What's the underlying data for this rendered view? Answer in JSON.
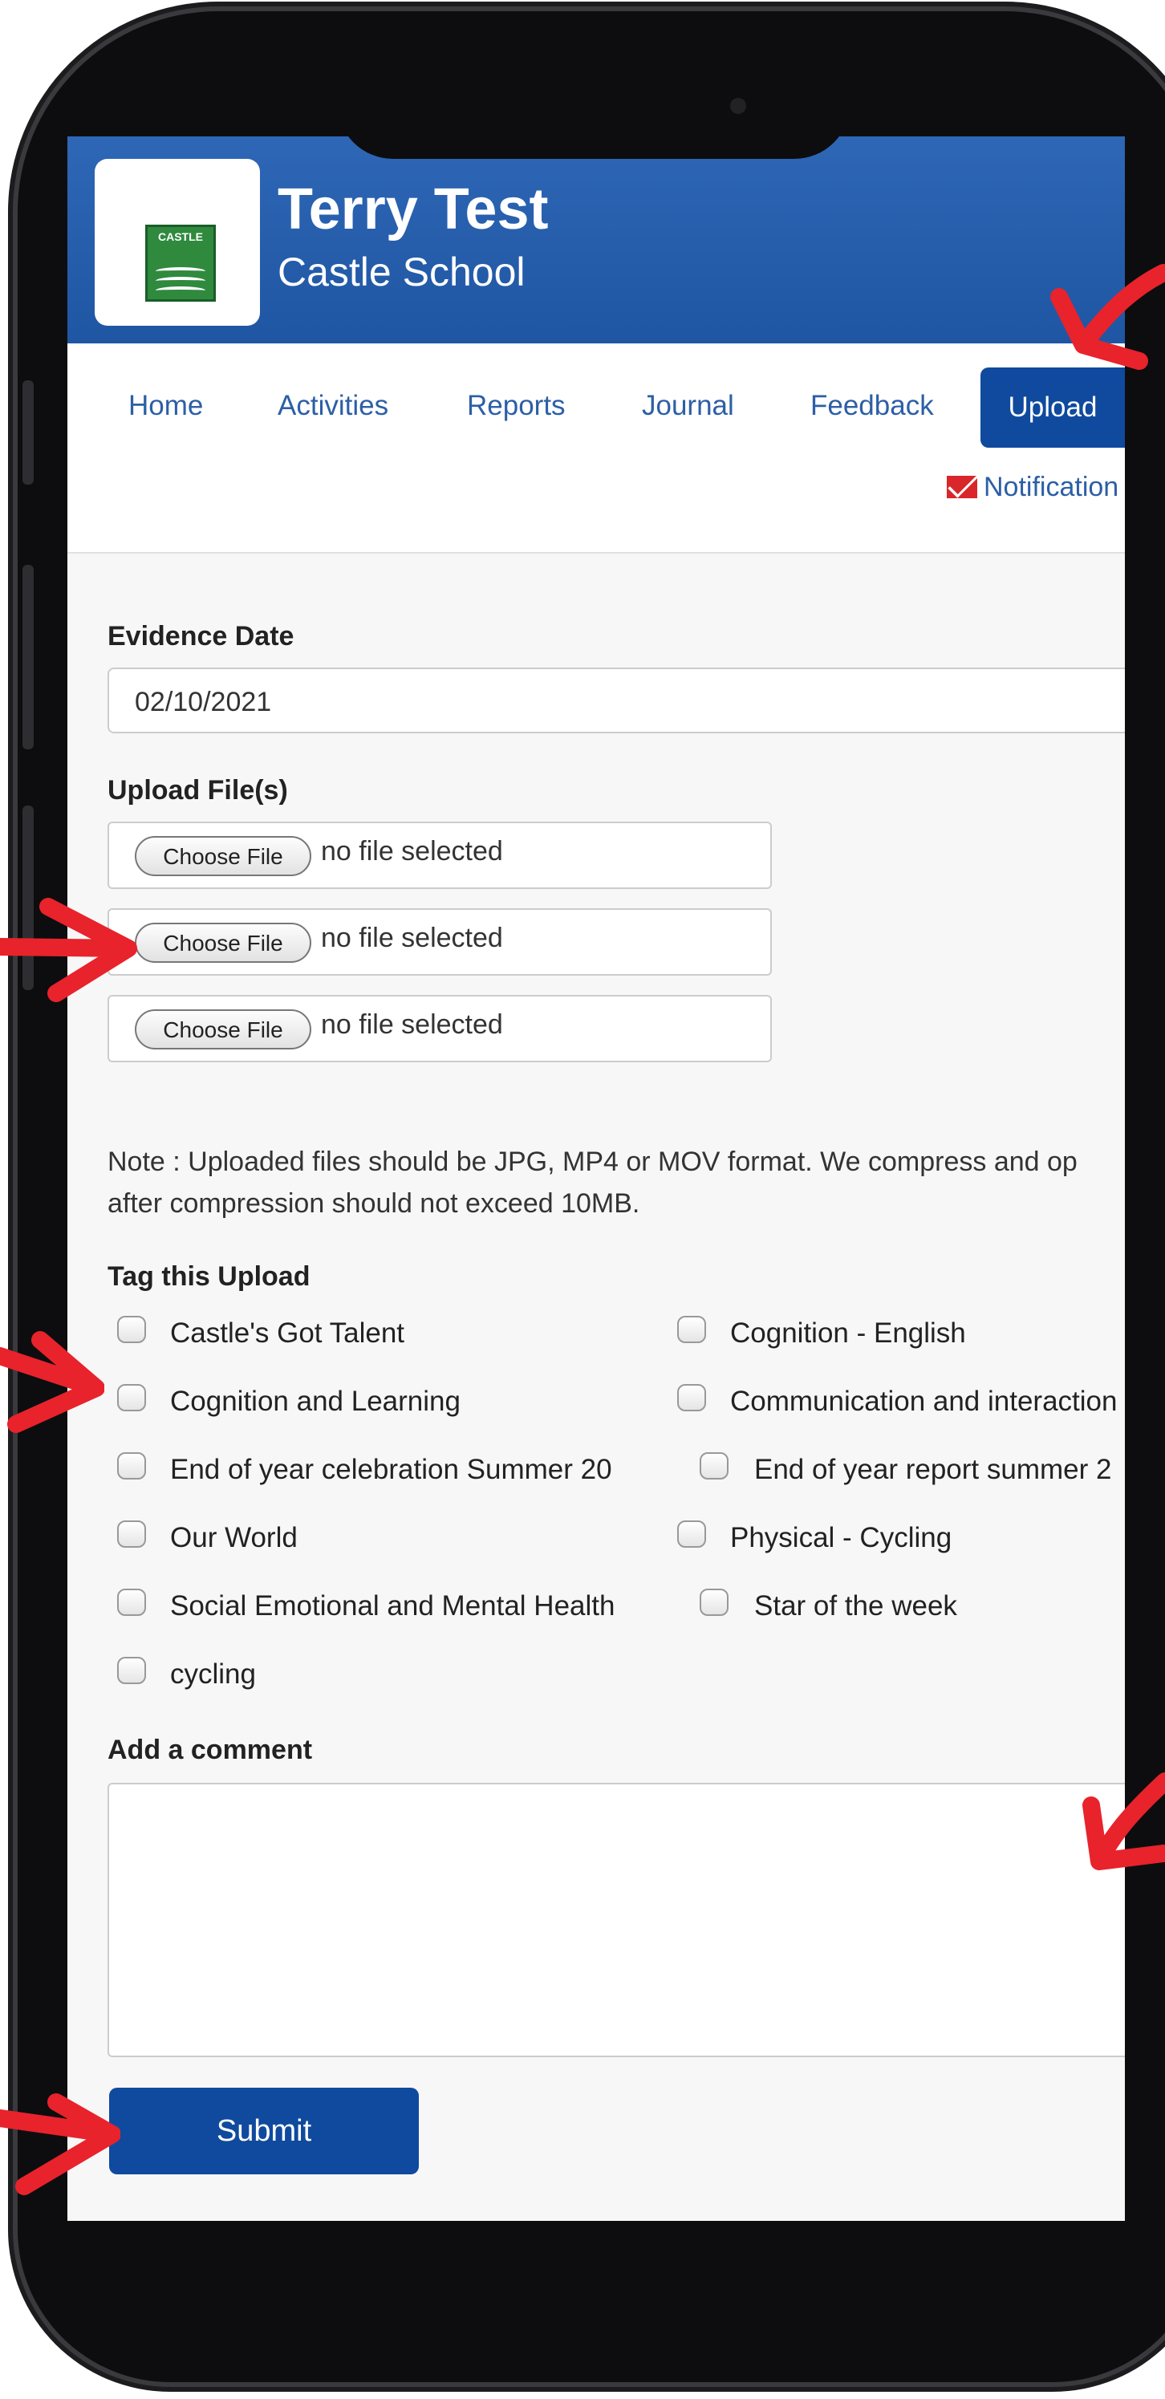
{
  "header": {
    "title": "Terry Test",
    "subtitle": "Castle School",
    "logo_text": "CASTLE"
  },
  "nav": {
    "items": [
      "Home",
      "Activities",
      "Reports",
      "Journal",
      "Feedback"
    ],
    "active": "Upload",
    "notifications": "Notification"
  },
  "form": {
    "evidence_date_label": "Evidence Date",
    "evidence_date_value": "02/10/2021",
    "upload_label": "Upload File(s)",
    "choose_file": "Choose File",
    "no_file": "no file selected",
    "note_line1": "Note : Uploaded files should be JPG, MP4 or MOV format. We compress and op",
    "note_line2": "after compression should not exceed 10MB.",
    "tag_label": "Tag this Upload",
    "tags_left": [
      "Castle's Got Talent",
      "Cognition and Learning",
      "End of year celebration Summer 20",
      "Our World",
      "Social Emotional and Mental Health",
      "cycling"
    ],
    "tags_right": [
      "Cognition - English",
      "Communication and interaction",
      "End of year report summer 2",
      "Physical - Cycling",
      "Star of the week"
    ],
    "comment_label": "Add a comment",
    "submit": "Submit"
  },
  "colors": {
    "brand_blue": "#0f4a9e",
    "header_blue": "#2e67b6",
    "arrow_red": "#e8232b"
  }
}
